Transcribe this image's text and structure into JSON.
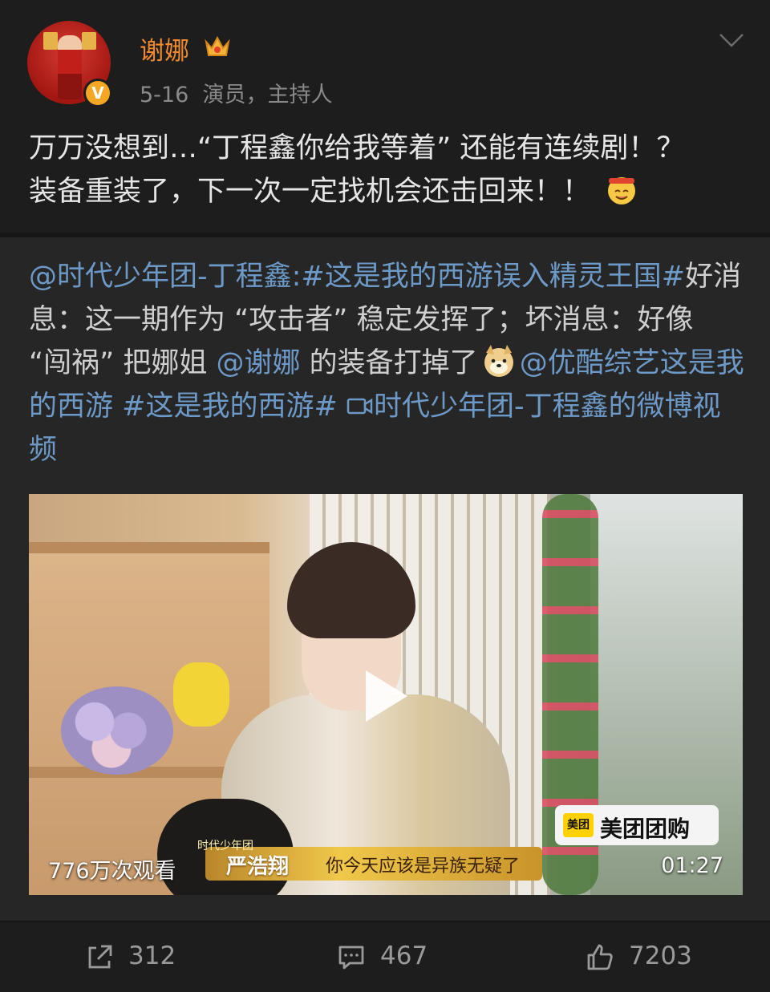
{
  "author": {
    "name": "谢娜",
    "time": "5-16",
    "desc": "演员，主持人",
    "verified_icon": "v-badge-icon",
    "vip_icon": "crown-icon"
  },
  "post": {
    "text_line1": "万万没想到…“丁程鑫你给我等着” 还能有连续剧！？",
    "text_line2": "装备重装了，下一次一定找机会还击回来！！",
    "emoji": "smiling-emoji-icon"
  },
  "repost": {
    "mention_author": "@时代少年团-丁程鑫",
    "colon": ":",
    "topic1": "#这是我的西游误入精灵王国#",
    "text1": "好消息：这一期作为 “攻击者” 稳定发挥了；坏消息：好像 “闯祸” 把娜姐",
    "mention2": "@谢娜",
    "text2": " 的装备打掉了",
    "emoji": "doge-emoji-icon",
    "mention3": "@优酷综艺这是我的西游",
    "topic2": "#这是我的西游#",
    "video_link": "时代少年团-丁程鑫的微博视频"
  },
  "video": {
    "views": "776万次观看",
    "duration": "01:27",
    "caption_tag": "时代少年团",
    "caption_name": "严浩翔",
    "caption_line": "你今天应该是异族无疑了",
    "sponsor_icon_text": "美团",
    "sponsor_text": "美团团购"
  },
  "actions": {
    "share_count": "312",
    "comment_count": "467",
    "like_count": "7203"
  }
}
